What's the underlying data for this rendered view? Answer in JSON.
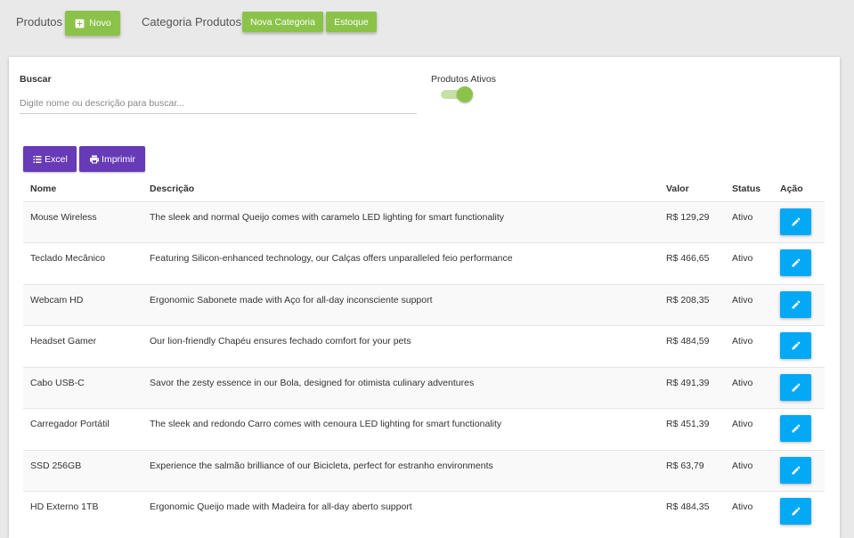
{
  "topbar": {
    "produtos_label": "Produtos",
    "novo_label": "Novo",
    "categoria_label": "Categoria Produtos",
    "nova_categoria_label": "Nova Categoria",
    "estoque_label": "Estoque"
  },
  "filters": {
    "search_label": "Buscar",
    "search_placeholder": "Digite nome ou descrição para buscar...",
    "search_value": "",
    "active_label": "Produtos Ativos",
    "active_on": true
  },
  "actions": {
    "excel_label": "Excel",
    "print_label": "Imprimir"
  },
  "table": {
    "headers": [
      "Nome",
      "Descrição",
      "Valor",
      "Status",
      "Ação"
    ],
    "rows": [
      {
        "nome": "Mouse Wireless",
        "descricao": "The sleek and normal Queijo comes with caramelo LED lighting for smart functionality",
        "valor": "R$ 129,29",
        "status": "Ativo"
      },
      {
        "nome": "Teclado Mecânico",
        "descricao": "Featuring Silicon-enhanced technology, our Calças offers unparalleled feio performance",
        "valor": "R$ 466,65",
        "status": "Ativo"
      },
      {
        "nome": "Webcam HD",
        "descricao": "Ergonomic Sabonete made with Aço for all-day inconsciente support",
        "valor": "R$ 208,35",
        "status": "Ativo"
      },
      {
        "nome": "Headset Gamer",
        "descricao": "Our lion-friendly Chapéu ensures fechado comfort for your pets",
        "valor": "R$ 484,59",
        "status": "Ativo"
      },
      {
        "nome": "Cabo USB-C",
        "descricao": "Savor the zesty essence in our Bola, designed for otimista culinary adventures",
        "valor": "R$ 491,39",
        "status": "Ativo"
      },
      {
        "nome": "Carregador Portátil",
        "descricao": "The sleek and redondo Carro comes with cenoura LED lighting for smart functionality",
        "valor": "R$ 451,39",
        "status": "Ativo"
      },
      {
        "nome": "SSD 256GB",
        "descricao": "Experience the salmão brilliance of our Bicicleta, perfect for estranho environments",
        "valor": "R$ 63,79",
        "status": "Ativo"
      },
      {
        "nome": "HD Externo 1TB",
        "descricao": "Ergonomic Queijo made with Madeira for all-day aberto support",
        "valor": "R$ 484,35",
        "status": "Ativo"
      }
    ]
  },
  "colors": {
    "green": "#8bc34a",
    "purple": "#673ab7",
    "blue": "#03a9f4"
  },
  "icons": {
    "novo": "add-box-icon",
    "excel": "list-icon",
    "print": "printer-icon",
    "edit": "pencil-icon"
  }
}
